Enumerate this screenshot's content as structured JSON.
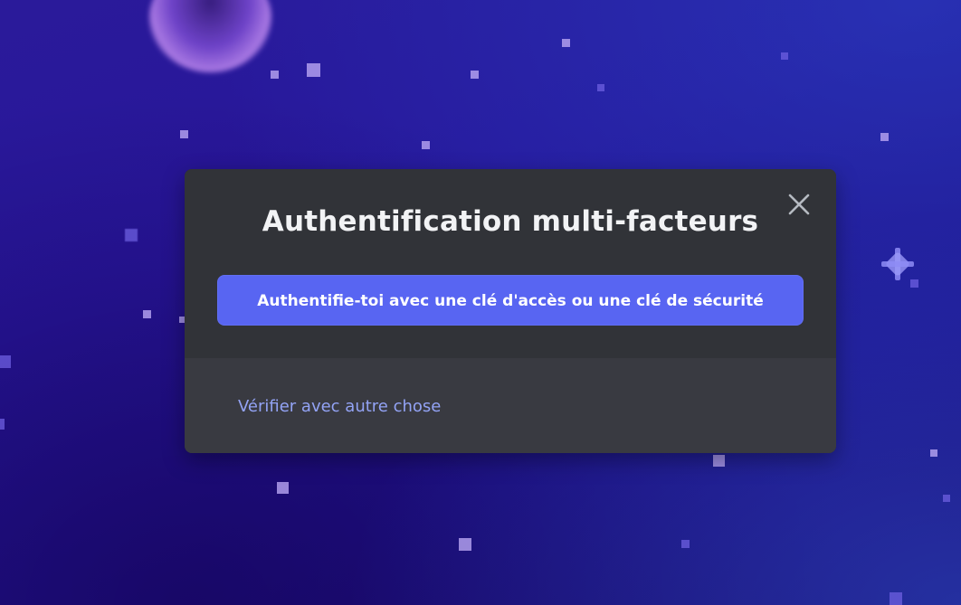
{
  "dialog": {
    "title": "Authentification multi-facteurs",
    "close_icon": "close-icon",
    "primary_button_label": "Authentifie-toi avec une clé d'accès ou une clé de sécurité",
    "alternate_link_label": "Vérifier avec autre chose"
  },
  "colors": {
    "accent": "#5865f2",
    "link": "#93a3f5",
    "dialog_background": "#313338",
    "footer_background": "#393a41"
  }
}
